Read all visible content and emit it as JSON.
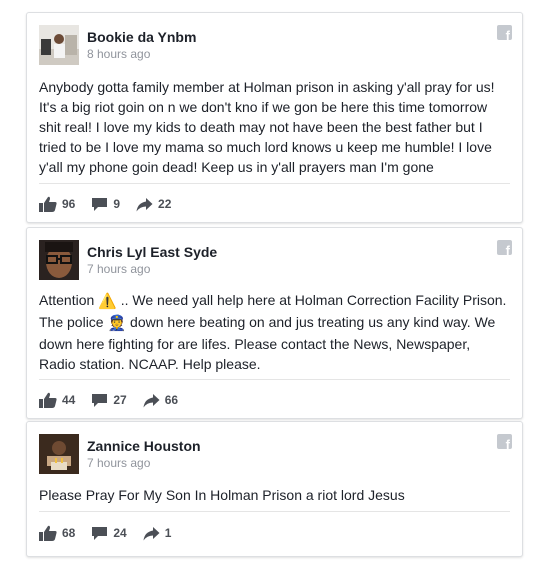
{
  "posts": [
    {
      "author": "Bookie da Ynbm",
      "time": "8 hours ago",
      "text": "Anybody gotta family member at Holman prison in asking y'all pray for us! It's a big riot goin on n we don't kno if we gon be here this time tomorrow shit real! I love my kids to death may not have been the best father but I tried to be I love my mama so much lord knows u keep me humble! I love y'all my phone goin dead! Keep us in y'all prayers man I'm gone",
      "likes": "96",
      "comments": "9",
      "shares": "22"
    },
    {
      "author": "Chris Lyl East Syde",
      "time": "7 hours ago",
      "text_part1": "Attention ",
      "emoji1": "⚠️",
      "text_part2": " .. We need yall help here at Holman Correction Facility Prison. The police ",
      "emoji2": "👮",
      "text_part3": " down here beating on and jus treating us any kind way. We down here fighting for are lifes. Please contact the News, Newspaper, Radio station. NCAAP. Help please.",
      "likes": "44",
      "comments": "27",
      "shares": "66"
    },
    {
      "author": "Zannice Houston",
      "time": "7 hours ago",
      "text": "Please Pray For My Son In Holman Prison a riot lord Jesus",
      "likes": "68",
      "comments": "24",
      "shares": "1"
    }
  ],
  "icons": {
    "brand": "facebook-icon",
    "like": "thumbs-up-icon",
    "comment": "comment-icon",
    "share": "share-arrow-icon"
  },
  "colors": {
    "icon_gray": "#4b4f56",
    "timestamp": "#90949c",
    "fb_badge": "#c5c9cf"
  }
}
